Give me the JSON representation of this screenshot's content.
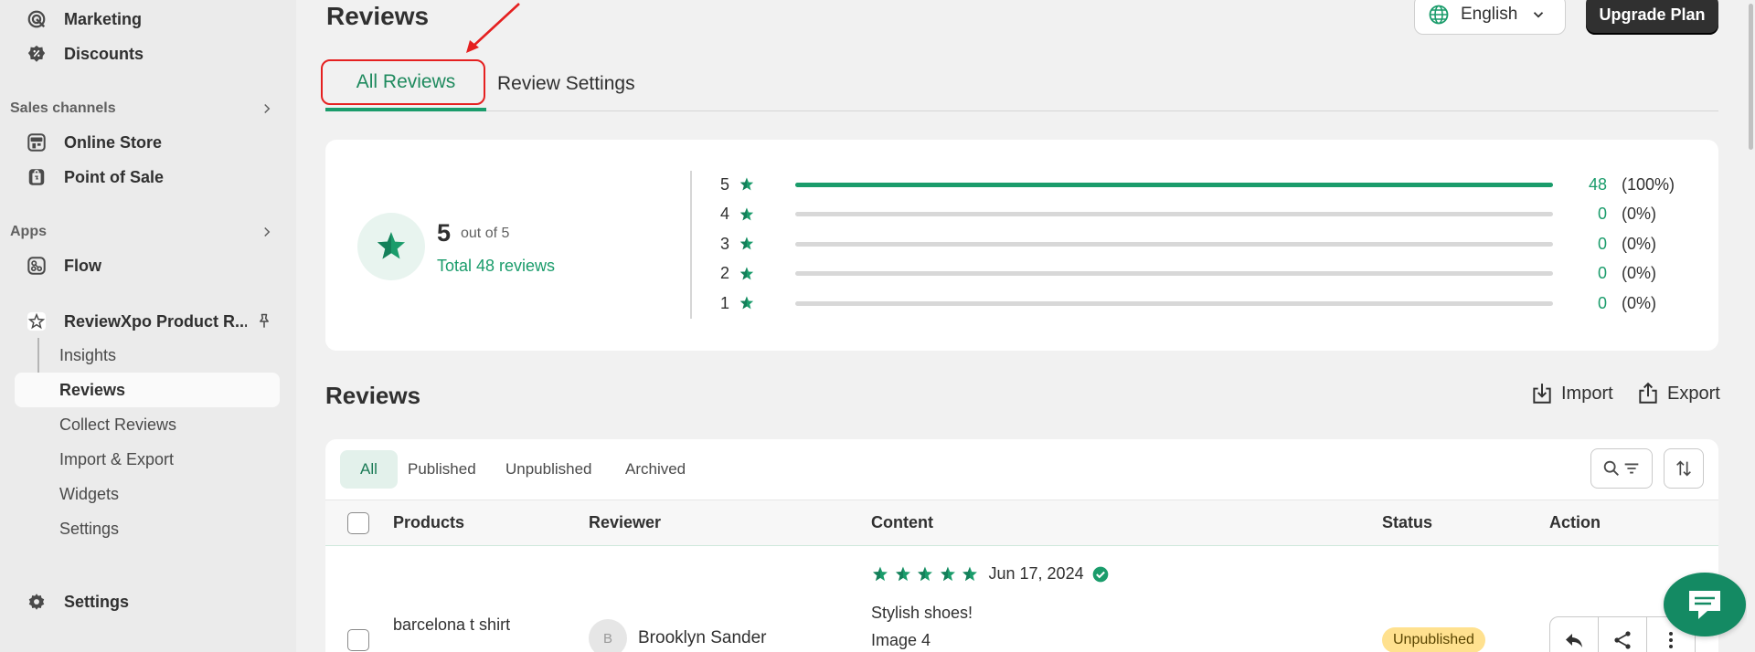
{
  "sidebar": {
    "items": [
      {
        "label": "Marketing",
        "icon": "target-icon"
      },
      {
        "label": "Discounts",
        "icon": "discount-icon"
      }
    ],
    "sales_channels": {
      "heading": "Sales channels",
      "items": [
        {
          "label": "Online Store",
          "icon": "store-icon"
        },
        {
          "label": "Point of Sale",
          "icon": "pos-icon"
        }
      ]
    },
    "apps": {
      "heading": "Apps",
      "items": [
        {
          "label": "Flow",
          "icon": "flow-icon"
        },
        {
          "label": "ReviewXpo Product R...",
          "icon": "star-app-icon"
        }
      ],
      "subitems": [
        "Insights",
        "Reviews",
        "Collect Reviews",
        "Import & Export",
        "Widgets",
        "Settings"
      ],
      "active_subitem": "Reviews"
    },
    "settings": {
      "label": "Settings",
      "icon": "gear-icon"
    }
  },
  "page": {
    "title": "Reviews",
    "language": "English",
    "upgrade_label": "Upgrade Plan",
    "tabs": [
      "All Reviews",
      "Review Settings"
    ],
    "active_tab": "All Reviews"
  },
  "summary": {
    "average": "5",
    "out_of": "out of 5",
    "total": "Total 48 reviews",
    "ratings": [
      {
        "stars": "5",
        "count": "48",
        "pct": "(100%)",
        "fraction": 1.0
      },
      {
        "stars": "4",
        "count": "0",
        "pct": "(0%)",
        "fraction": 0
      },
      {
        "stars": "3",
        "count": "0",
        "pct": "(0%)",
        "fraction": 0
      },
      {
        "stars": "2",
        "count": "0",
        "pct": "(0%)",
        "fraction": 0
      },
      {
        "stars": "1",
        "count": "0",
        "pct": "(0%)",
        "fraction": 0
      }
    ]
  },
  "reviews": {
    "title": "Reviews",
    "import_label": "Import",
    "export_label": "Export",
    "filters": [
      "All",
      "Published",
      "Unpublished",
      "Archived"
    ],
    "active_filter": "All",
    "columns": {
      "products": "Products",
      "reviewer": "Reviewer",
      "content": "Content",
      "status": "Status",
      "action": "Action"
    },
    "rows": [
      {
        "product": "barcelona t shirt",
        "reviewer_initial": "B",
        "reviewer": "Brooklyn Sander",
        "rating": 5,
        "date": "Jun 17, 2024",
        "content_title": "Stylish shoes!",
        "content_body": "Image 4",
        "status": "Unpublished"
      }
    ]
  },
  "colors": {
    "accent": "#1a9c6b",
    "highlight": "#e52020",
    "badge_unpublished": "#ffe18f"
  }
}
